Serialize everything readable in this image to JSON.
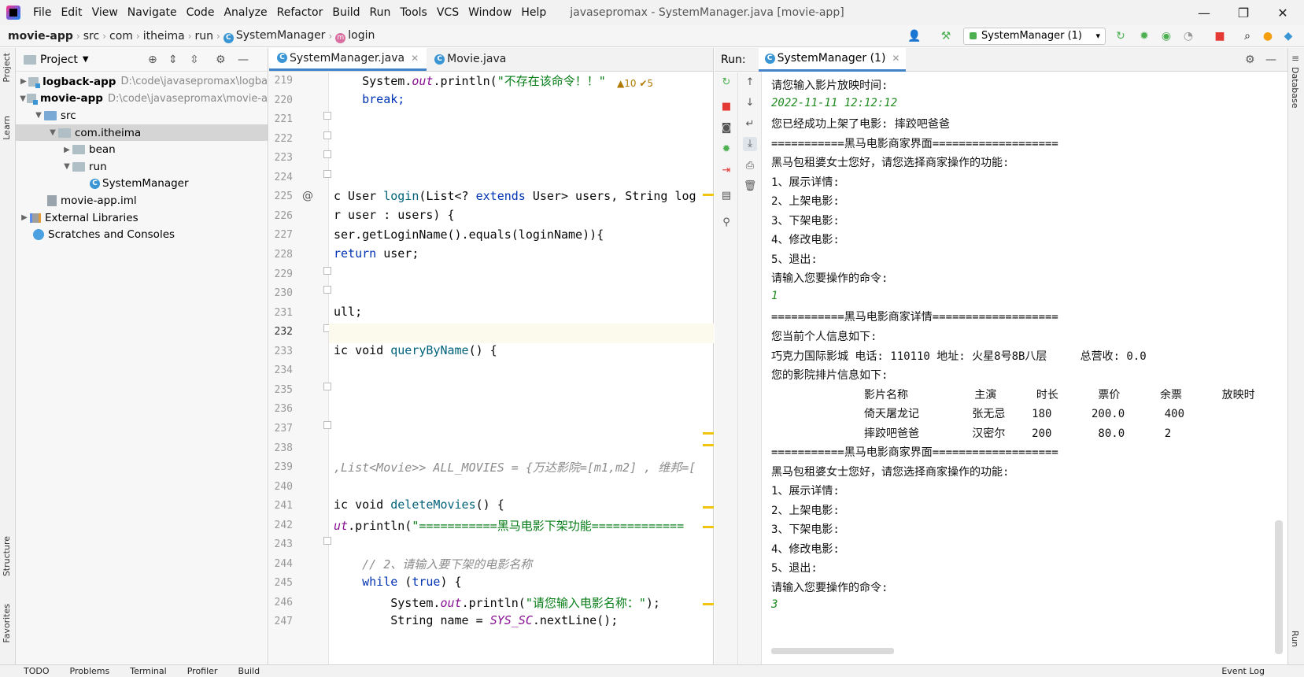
{
  "menubar": {
    "items": [
      "File",
      "Edit",
      "View",
      "Navigate",
      "Code",
      "Analyze",
      "Refactor",
      "Build",
      "Run",
      "Tools",
      "VCS",
      "Window",
      "Help"
    ],
    "title": "javasepromax - SystemManager.java [movie-app]"
  },
  "breadcrumb": {
    "items": [
      "movie-app",
      "src",
      "com",
      "itheima",
      "run",
      "SystemManager",
      "login"
    ],
    "run_config": "SystemManager (1)"
  },
  "side_tabs": {
    "project": "Project",
    "learn": "Learn",
    "structure": "Structure",
    "favorites": "Favorites",
    "database": "Database",
    "run": "Run"
  },
  "project": {
    "title": "Project",
    "tree": [
      {
        "label": "logback-app",
        "hint": "D:\\code\\javasepromax\\logba"
      },
      {
        "label": "movie-app",
        "hint": "D:\\code\\javasepromax\\movie-a"
      },
      {
        "label": "src"
      },
      {
        "label": "com.itheima"
      },
      {
        "label": "bean"
      },
      {
        "label": "run"
      },
      {
        "label": "SystemManager"
      },
      {
        "label": "movie-app.iml"
      },
      {
        "label": "External Libraries"
      },
      {
        "label": "Scratches and Consoles"
      }
    ]
  },
  "editor": {
    "tabs": [
      "SystemManager.java",
      "Movie.java"
    ],
    "warnings": "▲10 ✔5",
    "line_numbers": [
      "219",
      "220",
      "221",
      "222",
      "223",
      "224",
      "225",
      "226",
      "227",
      "228",
      "229",
      "230",
      "231",
      "232",
      "233",
      "234",
      "235",
      "236",
      "237",
      "238",
      "239",
      "240",
      "241",
      "242",
      "243",
      "244",
      "245",
      "246",
      "247"
    ],
    "lines": {
      "l219_a": "    System.",
      "l219_b": "out",
      "l219_c": ".println(",
      "l219_d": "\"不存在该命令！！\"",
      "l220": "    break;",
      "l225_a": "c User ",
      "l225_b": "login",
      "l225_c": "(List<? ",
      "l225_d": "extends",
      "l225_e": " User> users, String log",
      "l226": "r user : users) {",
      "l227": "ser.getLoginName().equals(loginName)){",
      "l228_a": "return",
      "l228_b": " user;",
      "l231": "ull;",
      "l233_a": "ic void ",
      "l233_b": "queryByName",
      "l233_c": "() {",
      "l239": ",List<Movie>> ALL_MOVIES = {万达影院=[m1,m2] , 维邦=[",
      "l241_a": "ic void ",
      "l241_b": "deleteMovies",
      "l241_c": "() {",
      "l242_a": "ut",
      "l242_b": ".println(",
      "l242_c": "\"===========黑马电影下架功能=============",
      "l244": "    // 2、请输入要下架的电影名称",
      "l245_a": "    while",
      "l245_b": " (",
      "l245_c": "true",
      "l245_d": ") {",
      "l246_a": "        System.",
      "l246_b": "out",
      "l246_c": ".println(",
      "l246_d": "\"请您输入电影名称：\"",
      "l246_e": ");",
      "l247_a": "        String name = ",
      "l247_b": "SYS_SC",
      "l247_c": ".nextLine();"
    }
  },
  "run": {
    "label": "Run:",
    "tab": "SystemManager (1)",
    "console": [
      {
        "t": "请您输入影片放映时间:",
        "in": false
      },
      {
        "t": "2022-11-11 12:12:12",
        "in": true
      },
      {
        "t": "您已经成功上架了电影: 摔跤吧爸爸",
        "in": false
      },
      {
        "t": "===========黑马电影商家界面===================",
        "in": false
      },
      {
        "t": "黑马包租婆女士您好，请您选择商家操作的功能:",
        "in": false
      },
      {
        "t": "1、展示详情:",
        "in": false
      },
      {
        "t": "2、上架电影:",
        "in": false
      },
      {
        "t": "3、下架电影:",
        "in": false
      },
      {
        "t": "4、修改电影:",
        "in": false
      },
      {
        "t": "5、退出:",
        "in": false
      },
      {
        "t": "请输入您要操作的命令:",
        "in": false
      },
      {
        "t": "1",
        "in": true
      },
      {
        "t": "===========黑马电影商家详情===================",
        "in": false
      },
      {
        "t": "您当前个人信息如下:",
        "in": false
      },
      {
        "t": "巧克力国际影城 电话: 110110 地址: 火星8号8B八层     总营收: 0.0",
        "in": false
      },
      {
        "t": "您的影院排片信息如下:",
        "in": false
      },
      {
        "t": "              影片名称          主演      时长      票价      余票      放映时",
        "in": false
      },
      {
        "t": "              倚天屠龙记        张无忌    180      200.0      400",
        "in": false
      },
      {
        "t": "              摔跤吧爸爸        汉密尔    200       80.0      2",
        "in": false
      },
      {
        "t": "===========黑马电影商家界面===================",
        "in": false
      },
      {
        "t": "黑马包租婆女士您好，请您选择商家操作的功能:",
        "in": false
      },
      {
        "t": "1、展示详情:",
        "in": false
      },
      {
        "t": "2、上架电影:",
        "in": false
      },
      {
        "t": "3、下架电影:",
        "in": false
      },
      {
        "t": "4、修改电影:",
        "in": false
      },
      {
        "t": "5、退出:",
        "in": false
      },
      {
        "t": "请输入您要操作的命令:",
        "in": false
      },
      {
        "t": "3",
        "in": true
      }
    ]
  },
  "statusbar": {
    "items": [
      "TODO",
      "Problems",
      "Terminal",
      "Profiler",
      "Build",
      "Event Log"
    ]
  }
}
